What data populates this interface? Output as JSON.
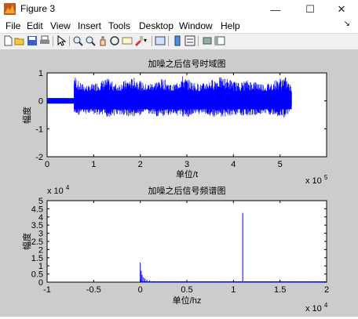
{
  "window": {
    "title": "Figure 3",
    "controls": {
      "minimize": "—",
      "maximize": "☐",
      "close": "✕"
    }
  },
  "menubar": {
    "items": [
      "File",
      "Edit",
      "View",
      "Insert",
      "Tools",
      "Desktop",
      "Window",
      "Help"
    ],
    "dock_arrow": "↘"
  },
  "toolbar": {
    "icons": [
      "new-figure-icon",
      "open-file-icon",
      "save-icon",
      "print-icon",
      "edit-plot-arrow-icon",
      "zoom-in-icon",
      "zoom-out-icon",
      "pan-icon",
      "rotate-3d-icon",
      "data-cursor-icon",
      "brush-icon",
      "link-plot-icon",
      "colorbar-icon",
      "legend-icon",
      "hide-plot-tools-icon",
      "show-plot-tools-icon"
    ]
  },
  "colors": {
    "series": "#0000ff",
    "figure_bg": "#cccccc",
    "axes_bg": "#ffffff"
  },
  "chart_data": [
    {
      "type": "line",
      "title": "加噪之后信号时域图",
      "xlabel": "单位/t",
      "ylabel": "幅度",
      "xlim": [
        0,
        600000
      ],
      "ylim": [
        -2,
        1
      ],
      "x_ticks": [
        0,
        100000,
        200000,
        300000,
        400000,
        500000
      ],
      "x_tick_labels": [
        "0",
        "1",
        "2",
        "3",
        "4",
        "5"
      ],
      "x_exponent": "x 10",
      "x_exponent_power": "5",
      "y_ticks": [
        -2,
        -1,
        0,
        1
      ],
      "y_tick_labels": [
        "-2",
        "-1",
        "0",
        "1"
      ],
      "series": [
        {
          "x_range": [
            0,
            525000
          ],
          "baseline_band": {
            "x_range": [
              0,
              58000
            ],
            "y_range": [
              -0.1,
              0.1
            ]
          },
          "envelope": {
            "x": [
              58000,
              70000,
              90000,
              110000,
              130000,
              150000,
              170000,
              190000,
              210000,
              230000,
              250000,
              270000,
              290000,
              310000,
              330000,
              350000,
              370000,
              390000,
              410000,
              430000,
              450000,
              470000,
              490000,
              510000,
              525000
            ],
            "y_max": [
              0.95,
              0.65,
              0.55,
              0.7,
              0.8,
              0.6,
              0.75,
              0.85,
              0.6,
              0.7,
              0.8,
              0.55,
              0.9,
              0.7,
              0.6,
              0.75,
              0.85,
              0.8,
              0.65,
              0.75,
              0.7,
              0.6,
              0.75,
              0.9,
              0.5
            ],
            "y_min": [
              -0.55,
              -0.5,
              -0.45,
              -0.55,
              -0.6,
              -0.5,
              -0.55,
              -0.6,
              -0.45,
              -0.55,
              -0.6,
              -0.45,
              -0.6,
              -0.55,
              -0.45,
              -0.55,
              -0.6,
              -0.55,
              -0.5,
              -0.55,
              -0.5,
              -0.45,
              -0.55,
              -0.6,
              -0.4
            ]
          }
        }
      ]
    },
    {
      "type": "line",
      "title": "加噪之后信号频谱图",
      "xlabel": "单位/hz",
      "ylabel": "幅度",
      "xlim": [
        -10000,
        20000
      ],
      "ylim": [
        0,
        50000
      ],
      "x_ticks": [
        -10000,
        -5000,
        0,
        5000,
        10000,
        15000,
        20000
      ],
      "x_tick_labels": [
        "-1",
        "-0.5",
        "0",
        "0.5",
        "1",
        "1.5",
        "2"
      ],
      "x_exponent": "x 10",
      "x_exponent_power": "4",
      "y_ticks": [
        0,
        5000,
        10000,
        15000,
        20000,
        25000,
        30000,
        35000,
        40000,
        45000,
        50000
      ],
      "y_tick_labels": [
        "0",
        "0.5",
        "1",
        "1.5",
        "2",
        "2.5",
        "3",
        "3.5",
        "4",
        "4.5",
        "5"
      ],
      "y_exponent": "x 10",
      "y_exponent_power": "4",
      "series": [
        {
          "spikes": [
            {
              "x": 0,
              "y": 12000
            },
            {
              "x": 100,
              "y": 7000
            },
            {
              "x": 200,
              "y": 4500
            },
            {
              "x": 350,
              "y": 3000
            },
            {
              "x": 500,
              "y": 2200
            },
            {
              "x": 700,
              "y": 1500
            },
            {
              "x": 1000,
              "y": 1000
            },
            {
              "x": 1500,
              "y": 600
            },
            {
              "x": 2500,
              "y": 300
            },
            {
              "x": 11000,
              "y": 42500
            }
          ],
          "x_range": [
            0,
            20000
          ],
          "floor": 150
        }
      ]
    }
  ]
}
